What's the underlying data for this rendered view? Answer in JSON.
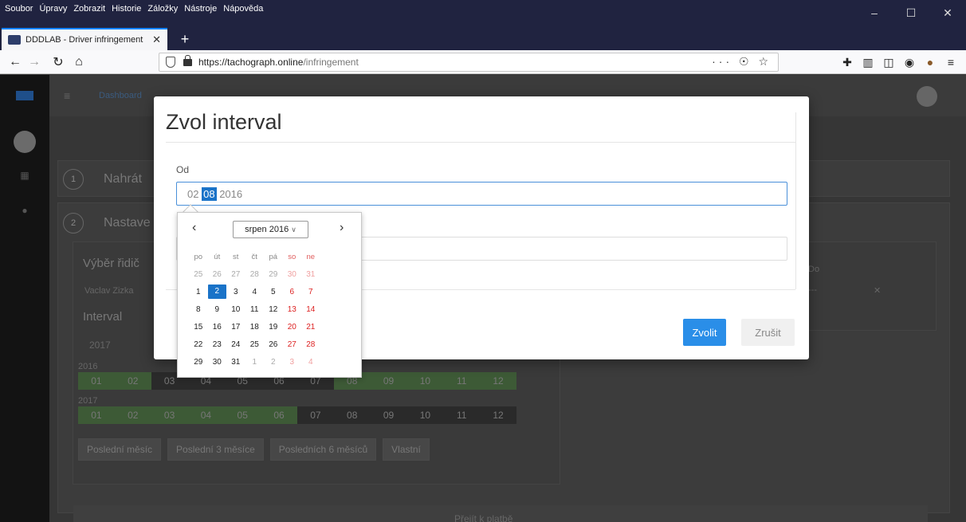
{
  "menu": [
    "Soubor",
    "Úpravy",
    "Zobrazit",
    "Historie",
    "Záložky",
    "Nástroje",
    "Nápověda"
  ],
  "tab": {
    "title": "DDDLAB - Driver infringement"
  },
  "url": {
    "host": "https://tachograph.online",
    "path": "/infringement",
    "actions": "··· ☉ ☆"
  },
  "background": {
    "breadcrumb": "Dashboard",
    "step1": {
      "num": "1",
      "title": "Nahrát"
    },
    "step2": {
      "num": "2",
      "title": "Nastave"
    },
    "driver_label": "Výběr řidič",
    "driver_value": "Vaclav Zizka",
    "interval_label": "Interval",
    "year_select": "2017",
    "do_label": "Do",
    "do_value": "---",
    "year1": "2016",
    "year2": "2017",
    "months": [
      "01",
      "02",
      "03",
      "04",
      "05",
      "06",
      "07",
      "08",
      "09",
      "10",
      "11",
      "12"
    ],
    "quick_buttons": [
      "Poslední měsíc",
      "Poslední 3 měsíce",
      "Posledních 6 měsíců",
      "Vlastní"
    ],
    "pay_button": "Přejít k platbě"
  },
  "modal": {
    "title": "Zvol interval",
    "od_label": "Od",
    "od_day": "02",
    "od_month": "08",
    "od_year": "2016",
    "do_label": "D",
    "confirm": "Zvolit",
    "cancel": "Zrušit"
  },
  "datepicker": {
    "prev": "‹",
    "next": "›",
    "month_label": "srpen 2016",
    "weekdays": [
      "po",
      "út",
      "st",
      "čt",
      "pá",
      "so",
      "ne"
    ],
    "weeks": [
      [
        "25",
        "26",
        "27",
        "28",
        "29",
        "30",
        "31"
      ],
      [
        "1",
        "2",
        "3",
        "4",
        "5",
        "6",
        "7"
      ],
      [
        "8",
        "9",
        "10",
        "11",
        "12",
        "13",
        "14"
      ],
      [
        "15",
        "16",
        "17",
        "18",
        "19",
        "20",
        "21"
      ],
      [
        "22",
        "23",
        "24",
        "25",
        "26",
        "27",
        "28"
      ],
      [
        "29",
        "30",
        "31",
        "1",
        "2",
        "3",
        "4"
      ]
    ],
    "selected": "2"
  }
}
